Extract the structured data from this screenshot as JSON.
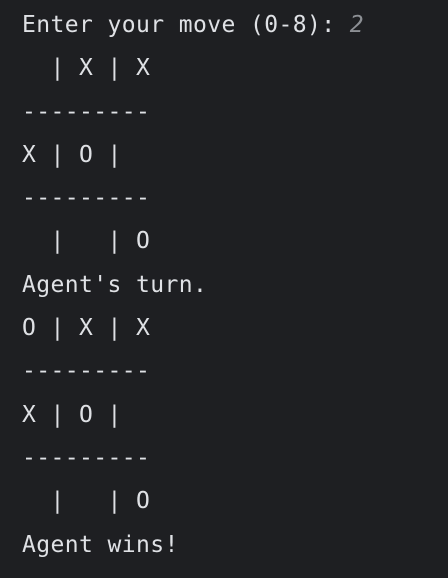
{
  "console": {
    "prompt": "Enter your move (0-8): ",
    "user_input": "2",
    "lines": [
      "  | X | X",
      "---------",
      "X | O |",
      "---------",
      "  |   | O",
      "Agent's turn.",
      "O | X | X",
      "---------",
      "X | O |",
      "---------",
      "  |   | O",
      "Agent wins!"
    ]
  },
  "colors": {
    "background": "#1e1f22",
    "text": "#dfe1e5",
    "input": "#8c8f94"
  }
}
